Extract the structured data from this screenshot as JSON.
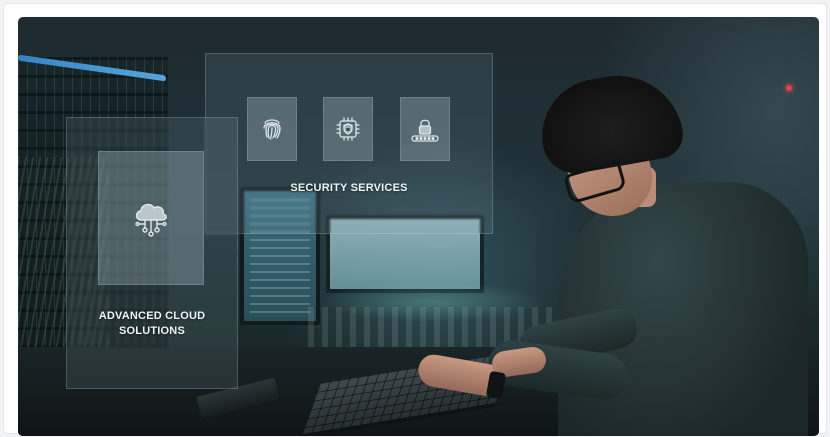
{
  "panels": {
    "security": {
      "label": "SECURITY SERVICES",
      "icons": [
        "fingerprint-icon",
        "chip-shield-icon",
        "password-lock-icon"
      ]
    },
    "cloud": {
      "label_line1": "ADVANCED CLOUD",
      "label_line2": "SOLUTIONS",
      "icon": "cloud-network-icon"
    }
  },
  "colors": {
    "panel_text": "#eef4f5",
    "icon_stroke": "#dce9ec",
    "accent_blue": "#3a8fd8"
  }
}
